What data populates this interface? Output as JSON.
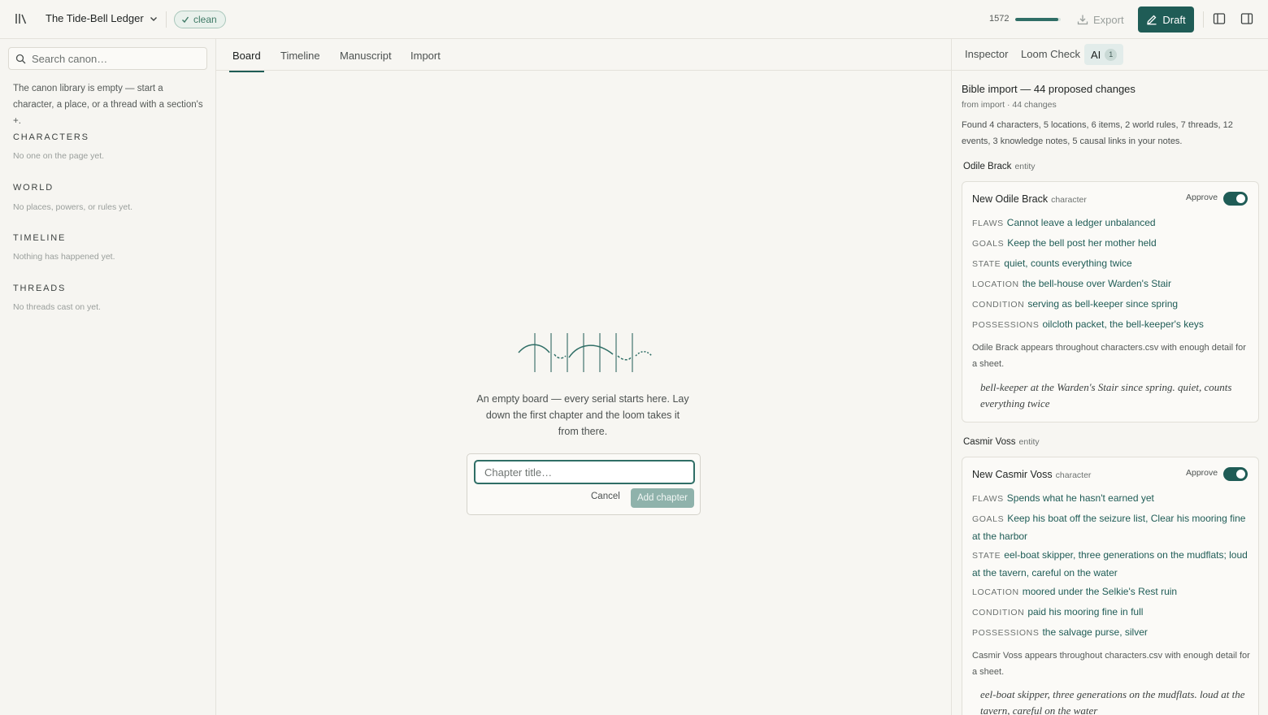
{
  "app": {
    "project_title": "The Tide-Bell Ledger",
    "status_badge": "clean",
    "word_count": "1572",
    "progress_fraction": 0.95,
    "export_label": "Export",
    "draft_label": "Draft",
    "accent_color": "#1f5c56"
  },
  "sidebar": {
    "search_placeholder": "Search canon…",
    "empty_note": "The canon library is empty — start a character, a place, or a thread with a section's +.",
    "sections": [
      {
        "title": "CHARACTERS",
        "empty": "No one on the page yet."
      },
      {
        "title": "WORLD",
        "empty": "No places, powers, or rules yet."
      },
      {
        "title": "TIMELINE",
        "empty": "Nothing has happened yet."
      },
      {
        "title": "THREADS",
        "empty": "No threads cast on yet."
      }
    ]
  },
  "main": {
    "tabs": [
      "Board",
      "Timeline",
      "Manuscript",
      "Import"
    ],
    "active_tab": "Board",
    "empty_message": "An empty board — every serial starts here. Lay down the first chapter and the loom takes it from there.",
    "chapter_placeholder": "Chapter title…",
    "cancel_label": "Cancel",
    "add_label": "Add chapter"
  },
  "inspector": {
    "tabs": [
      "Inspector",
      "Loom Check",
      "AI"
    ],
    "ai_count": "1",
    "import_title": "Bible import — 44 proposed changes",
    "import_sub": "from import · 44 changes",
    "import_desc": "Found 4 characters, 5 locations, 6 items, 2 world rules, 7 threads, 12 events, 3 knowledge notes, 5 causal links in your notes.",
    "entities": [
      {
        "name": "Odile Brack",
        "kind": "entity",
        "card_title": "New Odile Brack",
        "card_kind": "character",
        "approve_label": "Approve",
        "approved": true,
        "fields": [
          {
            "key": "FLAWS",
            "value": "Cannot leave a ledger unbalanced"
          },
          {
            "key": "GOALS",
            "value": "Keep the bell post her mother held"
          },
          {
            "key": "STATE",
            "value": "quiet, counts everything twice"
          },
          {
            "key": "LOCATION",
            "value": "the bell-house over Warden's Stair"
          },
          {
            "key": "CONDITION",
            "value": "serving as bell-keeper since spring"
          },
          {
            "key": "POSSESSIONS",
            "value": "oilcloth packet, the bell-keeper's keys"
          }
        ],
        "note": "Odile Brack appears throughout characters.csv with enough detail for a sheet.",
        "quote": "bell-keeper at the Warden's Stair since spring. quiet, counts everything twice"
      },
      {
        "name": "Casmir Voss",
        "kind": "entity",
        "card_title": "New Casmir Voss",
        "card_kind": "character",
        "approve_label": "Approve",
        "approved": true,
        "fields": [
          {
            "key": "FLAWS",
            "value": "Spends what he hasn't earned yet"
          },
          {
            "key": "GOALS",
            "value": "Keep his boat off the seizure list, Clear his mooring fine at the harbor"
          },
          {
            "key": "STATE",
            "value": "eel-boat skipper, three generations on the mudflats; loud at the tavern, careful on the water"
          },
          {
            "key": "LOCATION",
            "value": "moored under the Selkie's Rest ruin"
          },
          {
            "key": "CONDITION",
            "value": "paid his mooring fine in full"
          },
          {
            "key": "POSSESSIONS",
            "value": "the salvage purse, silver"
          }
        ],
        "note": "Casmir Voss appears throughout characters.csv with enough detail for a sheet.",
        "quote": "eel-boat skipper, three generations on the mudflats. loud at the tavern, careful on the water"
      }
    ]
  },
  "icons": {
    "library": "library-icon",
    "chevron": "chevron-down-icon",
    "check": "check-icon",
    "download": "download-icon",
    "pencil": "pencil-icon",
    "panel_left": "panel-left-icon",
    "panel_right": "panel-right-icon",
    "search": "search-icon",
    "loom": "loom-illustration-icon"
  }
}
